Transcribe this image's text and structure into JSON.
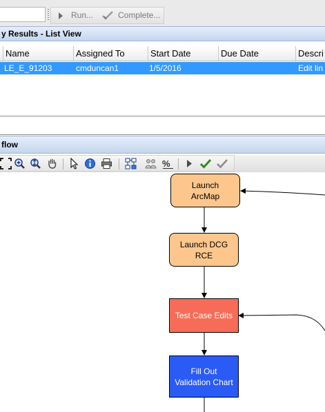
{
  "toolbar": {
    "run_label": "Run...",
    "complete_label": "Complete..."
  },
  "results_panel": {
    "title": "y Results - List View",
    "columns": [
      "Name",
      "Assigned To",
      "Start Date",
      "Due Date",
      "Descri"
    ],
    "rows": [
      {
        "name": "LE_E_91203",
        "assigned_to": "cmduncan1",
        "start_date": "1/5/2016",
        "due_date": "",
        "description": "Edit lin"
      }
    ]
  },
  "workflow_panel": {
    "title": "flow",
    "nodes": [
      {
        "line1": "Launch",
        "line2": "ArcMap",
        "color": "#fcc68c"
      },
      {
        "line1": "Launch DCG",
        "line2": "RCE",
        "color": "#fcc68c"
      },
      {
        "line1": "Test Case Edits",
        "color": "#f76c58"
      },
      {
        "line1": "Fill Out",
        "line2": "Validation Chart",
        "color": "#2b5bf5"
      }
    ]
  },
  "colors": {
    "selection": "#3399ff",
    "header_gradient_top": "#e6effa",
    "header_gradient_bottom": "#c3d6ee"
  }
}
